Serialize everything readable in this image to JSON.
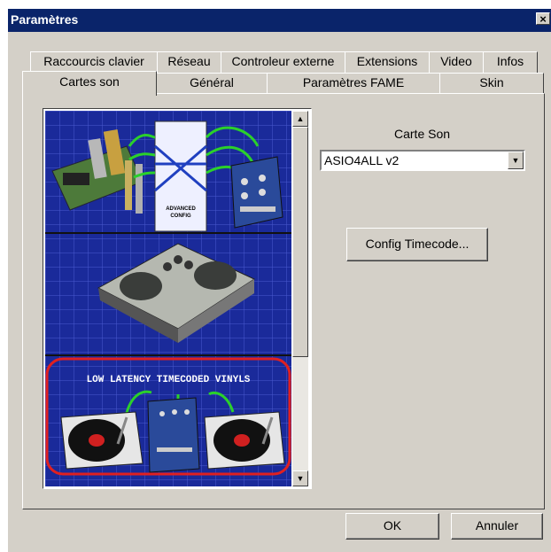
{
  "window": {
    "title": "Paramètres",
    "close": "×"
  },
  "tabs": {
    "row_back": [
      "Raccourcis clavier",
      "Réseau",
      "Controleur externe",
      "Extensions",
      "Video",
      "Infos"
    ],
    "row_front": [
      "Cartes son",
      "Général",
      "Paramètres FAME",
      "Skin"
    ],
    "active": "Cartes son"
  },
  "sound": {
    "label": "Carte Son",
    "selected": "ASIO4ALL v2",
    "config_button": "Config Timecode..."
  },
  "illustration": {
    "routing_label": "ADVANCED\nCONFIG",
    "banner": "LOW LATENCY TIMECODED VINYLS"
  },
  "scroll": {
    "up": "▲",
    "down": "▼"
  },
  "buttons": {
    "ok": "OK",
    "cancel": "Annuler"
  },
  "colors": {
    "titlebar": "#0a246a",
    "dialog": "#d4d0c8",
    "art_bg": "#1b2b9a",
    "highlight_red": "#e02020"
  }
}
